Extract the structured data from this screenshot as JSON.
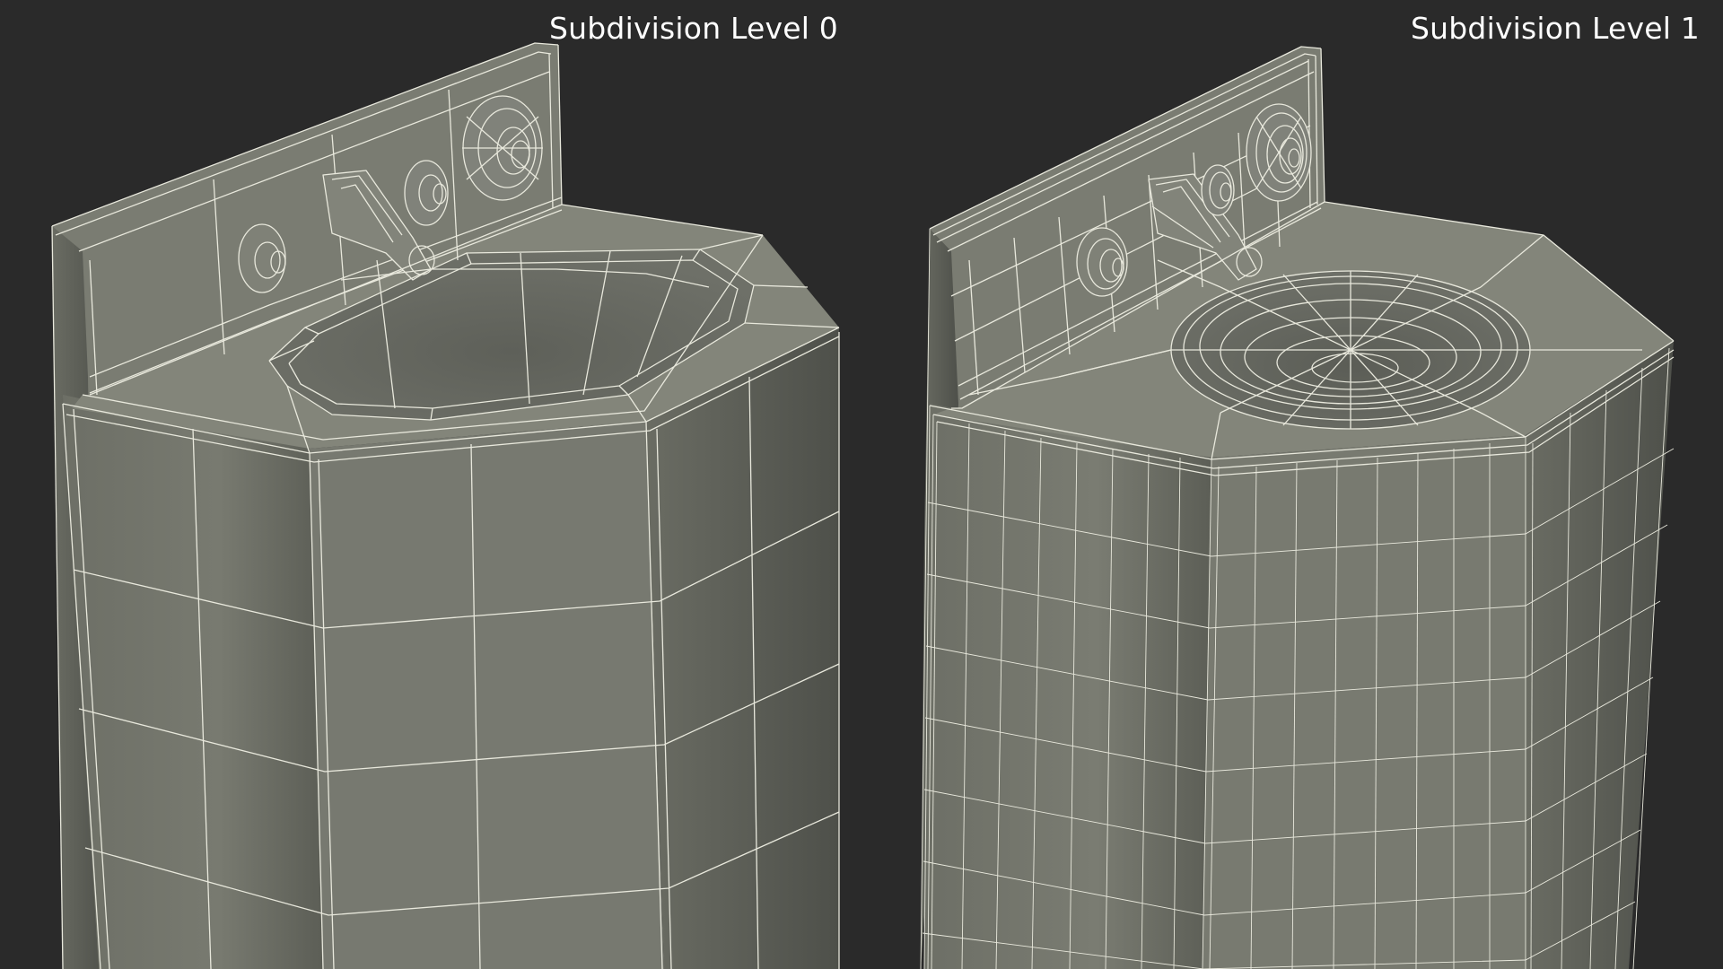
{
  "viewports": [
    {
      "label": "Subdivision Level 0",
      "subdivision_level": 0
    },
    {
      "label": "Subdivision Level 1",
      "subdivision_level": 1
    }
  ],
  "colors": {
    "background": "#2a2a2a",
    "mesh_surface": "#777a6f",
    "wireframe": "#e8e8dc",
    "label_text": "#ffffff"
  }
}
